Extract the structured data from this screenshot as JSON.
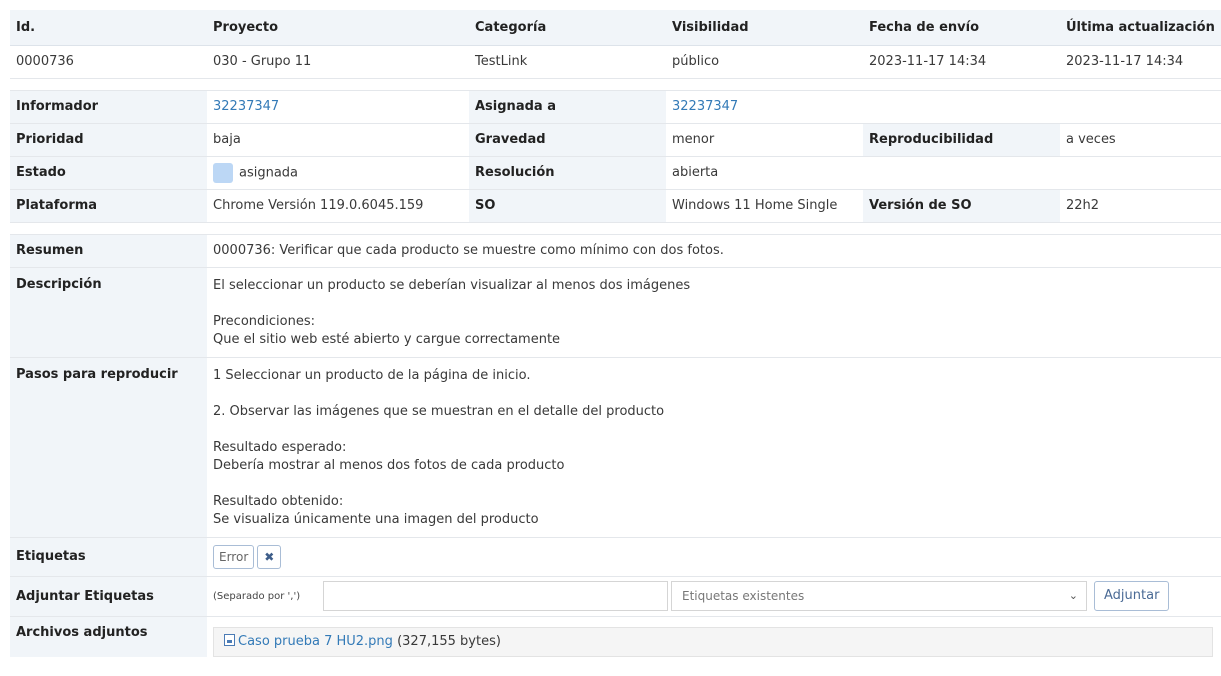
{
  "header": {
    "cols": [
      "Id.",
      "Proyecto",
      "Categoría",
      "Visibilidad",
      "Fecha de envío",
      "Última actualización"
    ],
    "values": [
      "0000736",
      "030 - Grupo 11",
      "TestLink",
      "público",
      "2023-11-17 14:34",
      "2023-11-17 14:34"
    ]
  },
  "details": {
    "informador_label": "Informador",
    "informador": "32237347",
    "asignada_label": "Asignada a",
    "asignada": "32237347",
    "prioridad_label": "Prioridad",
    "prioridad": "baja",
    "gravedad_label": "Gravedad",
    "gravedad": "menor",
    "reproducibilidad_label": "Reproducibilidad",
    "reproducibilidad": "a veces",
    "estado_label": "Estado",
    "estado": "asignada",
    "resolucion_label": "Resolución",
    "resolucion": "abierta",
    "plataforma_label": "Plataforma",
    "plataforma": "Chrome Versión 119.0.6045.159",
    "so_label": "SO",
    "so": "Windows 11 Home Single",
    "version_so_label": "Versión de SO",
    "version_so": "22h2"
  },
  "colors": {
    "link": "#337ab7",
    "status_asignada": "#bcd7f5"
  },
  "resumen": {
    "label": "Resumen",
    "text": "0000736: Verificar que cada producto se muestre como mínimo con dos fotos."
  },
  "descripcion": {
    "label": "Descripción",
    "p1": "El seleccionar un producto se deberían visualizar al menos dos imágenes",
    "p2_line1": "Precondiciones:",
    "p2_line2": "Que el sitio web esté abierto y cargue correctamente"
  },
  "pasos": {
    "label": "Pasos para reproducir",
    "p1": "1 Seleccionar un producto de la página de inicio.",
    "p2": "2. Observar las imágenes que se muestran en el detalle del producto",
    "p3_line1": "Resultado esperado:",
    "p3_line2": "Debería mostrar al menos dos fotos de cada producto",
    "p4_line1": "Resultado obtenido:",
    "p4_line2": "Se visualiza únicamente una imagen del producto"
  },
  "etiquetas": {
    "label": "Etiquetas",
    "tag": "Error",
    "remove_icon": "x-icon"
  },
  "adjuntar": {
    "label": "Adjuntar Etiquetas",
    "hint": "(Separado por ',')",
    "select_placeholder": "Etiquetas existentes",
    "button": "Adjuntar"
  },
  "archivos": {
    "label": "Archivos adjuntos",
    "file_icon": "image-file-icon",
    "file_name": "Caso prueba 7 HU2.png",
    "file_size": "(327,155 bytes)"
  }
}
